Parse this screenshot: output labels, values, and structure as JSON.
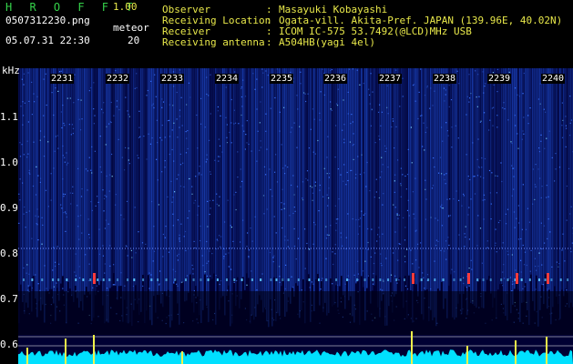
{
  "header": {
    "app_title": "H R O F F T",
    "version": "1.00",
    "filename": "0507312230.png",
    "meteor_label": "meteor",
    "timestamp": "05.07.31 22:30",
    "meteor_count": "20"
  },
  "info": [
    {
      "label": "Observer",
      "value": "Masayuki Kobayashi"
    },
    {
      "label": "Receiving Location",
      "value": "Ogata-vill. Akita-Pref. JAPAN (139.96E, 40.02N)"
    },
    {
      "label": "Receiver",
      "value": "ICOM IC-575 53.7492(@LCD)MHz USB"
    },
    {
      "label": "Receiving antenna",
      "value": "A504HB(yagi 4el)"
    }
  ],
  "plot": {
    "y_unit": "kHz",
    "y_ticks": [
      "1.1",
      "1.0",
      "0.9",
      "0.8",
      "0.7",
      "0.6"
    ],
    "minute_ticks": [
      "2231",
      "2232",
      "2233",
      "2234",
      "2235",
      "2236",
      "2237",
      "2238",
      "2239",
      "2240"
    ],
    "colors": {
      "background": "#000033",
      "noise": "#1f4fd6",
      "signal": "#ff3b3b",
      "baseline": "#00e0ff",
      "meteor_peak": "#f2f24a"
    }
  }
}
